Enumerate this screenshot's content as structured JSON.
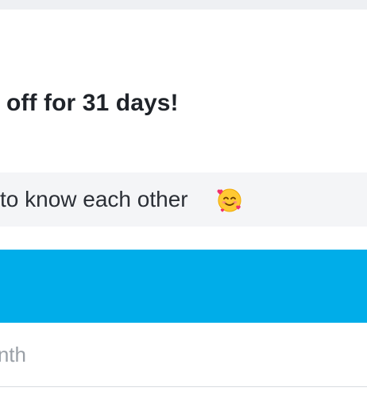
{
  "promo": {
    "headline": "off for 31 days!",
    "banner_text": "to know each other",
    "banner_icon": "smiling-face-with-hearts-icon"
  },
  "cta": {
    "color": "#00ade9"
  },
  "field": {
    "text": "nth"
  }
}
